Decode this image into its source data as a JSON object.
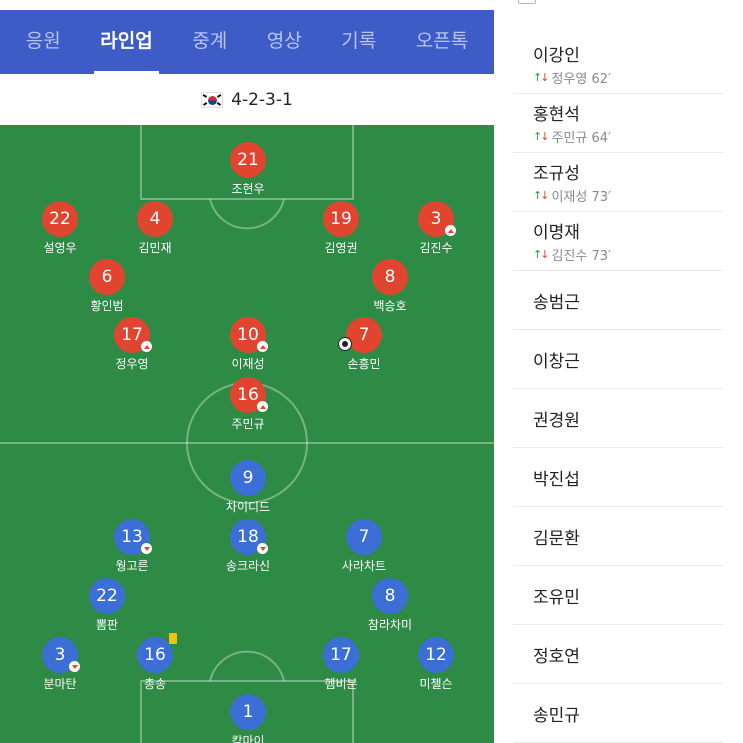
{
  "tabs": [
    {
      "label": "응원",
      "active": false
    },
    {
      "label": "라인업",
      "active": true
    },
    {
      "label": "중계",
      "active": false
    },
    {
      "label": "영상",
      "active": false
    },
    {
      "label": "기록",
      "active": false
    },
    {
      "label": "오픈톡",
      "active": false
    }
  ],
  "formation": {
    "flag": "south-korea-flag-icon",
    "text": "4-2-3-1"
  },
  "colors": {
    "tab_bar": "#3d5cc7",
    "pitch": "#2e8b45",
    "home": "#e2452f",
    "away": "#3b6fd6"
  },
  "home_players": [
    {
      "number": "21",
      "name": "조현우"
    },
    {
      "number": "22",
      "name": "설영우"
    },
    {
      "number": "4",
      "name": "김민재"
    },
    {
      "number": "19",
      "name": "김영권"
    },
    {
      "number": "3",
      "name": "김진수",
      "badge": "sub-up"
    },
    {
      "number": "6",
      "name": "황인범"
    },
    {
      "number": "8",
      "name": "백승호"
    },
    {
      "number": "17",
      "name": "정우영",
      "badge": "sub-up"
    },
    {
      "number": "10",
      "name": "이재성",
      "badge": "sub-up"
    },
    {
      "number": "7",
      "name": "손흥민",
      "badge": "goal"
    },
    {
      "number": "16",
      "name": "주민규",
      "badge": "sub-up"
    }
  ],
  "away_players": [
    {
      "number": "9",
      "name": "차이디드"
    },
    {
      "number": "13",
      "name": "웡고른",
      "badge": "sub-down"
    },
    {
      "number": "18",
      "name": "송크라신",
      "badge": "sub-down"
    },
    {
      "number": "7",
      "name": "사라차트"
    },
    {
      "number": "22",
      "name": "뽐판"
    },
    {
      "number": "8",
      "name": "참라차미"
    },
    {
      "number": "3",
      "name": "분마탄",
      "badge": "sub-down"
    },
    {
      "number": "16",
      "name": "총송",
      "badge": "yellow-card"
    },
    {
      "number": "17",
      "name": "헴비분"
    },
    {
      "number": "12",
      "name": "미첼슨"
    },
    {
      "number": "1",
      "name": "캄마이"
    }
  ],
  "bench": [
    {
      "name": "이강인",
      "sub_for": "정우영 62′"
    },
    {
      "name": "홍현석",
      "sub_for": "주민규 64′"
    },
    {
      "name": "조규성",
      "sub_for": "이재성 73′"
    },
    {
      "name": "이명재",
      "sub_for": "김진수 73′"
    },
    {
      "name": "송범근"
    },
    {
      "name": "이창근"
    },
    {
      "name": "권경원"
    },
    {
      "name": "박진섭"
    },
    {
      "name": "김문환"
    },
    {
      "name": "조유민"
    },
    {
      "name": "정호연"
    },
    {
      "name": "송민규"
    }
  ]
}
